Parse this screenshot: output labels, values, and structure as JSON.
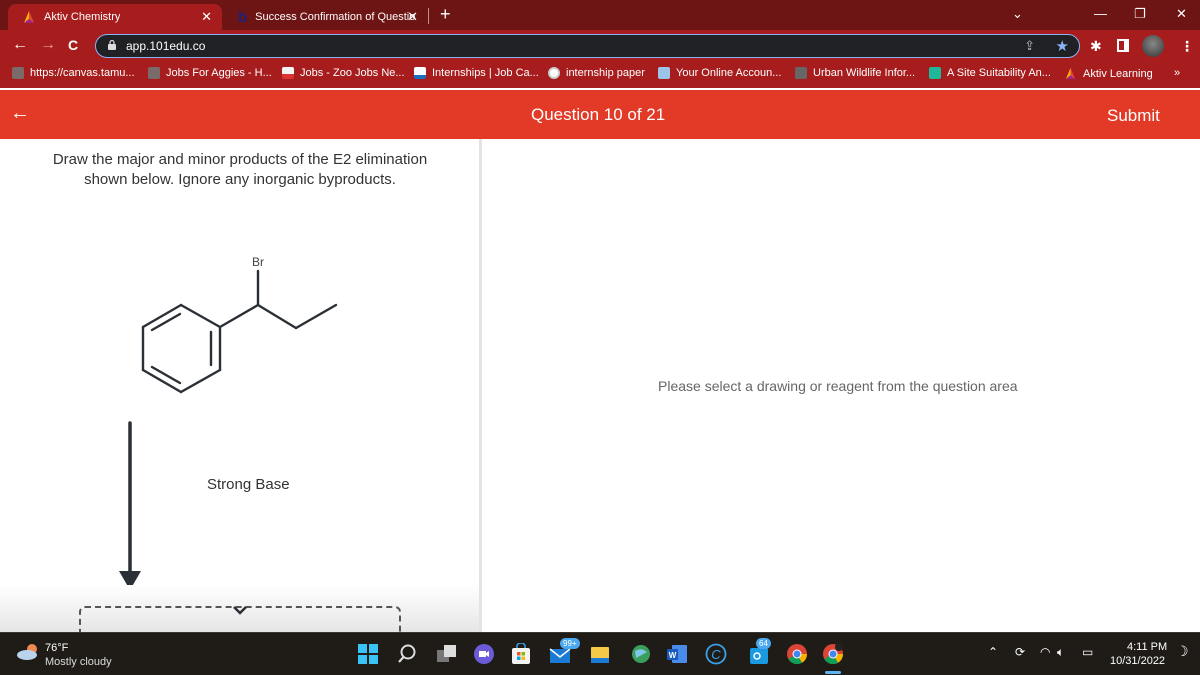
{
  "browser": {
    "tabs": [
      {
        "title": "Aktiv Chemistry",
        "active": true,
        "icon": "aktiv-logo-icon"
      },
      {
        "title": "Success Confirmation of Questio",
        "active": false,
        "icon": "bartleby-b-icon"
      }
    ],
    "close_glyph": "✕",
    "new_tab_glyph": "+",
    "window_controls": {
      "dropdown": "⌄",
      "minimize": "—",
      "restore": "❐",
      "close": "✕"
    },
    "nav": {
      "back": "←",
      "forward": "→",
      "reload": "C"
    },
    "url": "app.101edu.co",
    "bookmarks": [
      {
        "label": "https://canvas.tamu...",
        "icon": "tamu-icon"
      },
      {
        "label": "Jobs For Aggies - H...",
        "icon": "tamu-icon"
      },
      {
        "label": "Jobs - Zoo Jobs Ne...",
        "icon": "aza-icon"
      },
      {
        "label": "Internships | Job Ca...",
        "icon": "internships-icon"
      },
      {
        "label": "internship paper",
        "icon": "globe-icon"
      },
      {
        "label": "Your Online Accoun...",
        "icon": "account-icon"
      },
      {
        "label": "Urban Wildlife Infor...",
        "icon": "cube-icon"
      },
      {
        "label": "A Site Suitability An...",
        "icon": "teams-doc-icon"
      },
      {
        "label": "Aktiv Learning",
        "icon": "aktiv-logo-icon"
      }
    ],
    "bookmarks_overflow": "»"
  },
  "app": {
    "back_glyph": "←",
    "question_counter": "Question 10 of 21",
    "submit_label": "Submit",
    "prompt": "Draw the major and minor products of the E2 elimination shown below. Ignore any inorganic byproducts.",
    "molecule": {
      "name": "1-bromo-1-phenylpropane",
      "atom_label": "Br"
    },
    "reagent": "Strong Base",
    "placeholder_message": "Please select a drawing or reagent from the question area"
  },
  "taskbar": {
    "weather": {
      "temp": "76°F",
      "desc": "Mostly cloudy"
    },
    "mail_badge": "99+",
    "outlook_badge": "64",
    "time": "4:11 PM",
    "date": "10/31/2022"
  },
  "colors": {
    "header": "#e23a26",
    "tabstrip": "#6d1414",
    "toolbar": "#a71d1d"
  }
}
